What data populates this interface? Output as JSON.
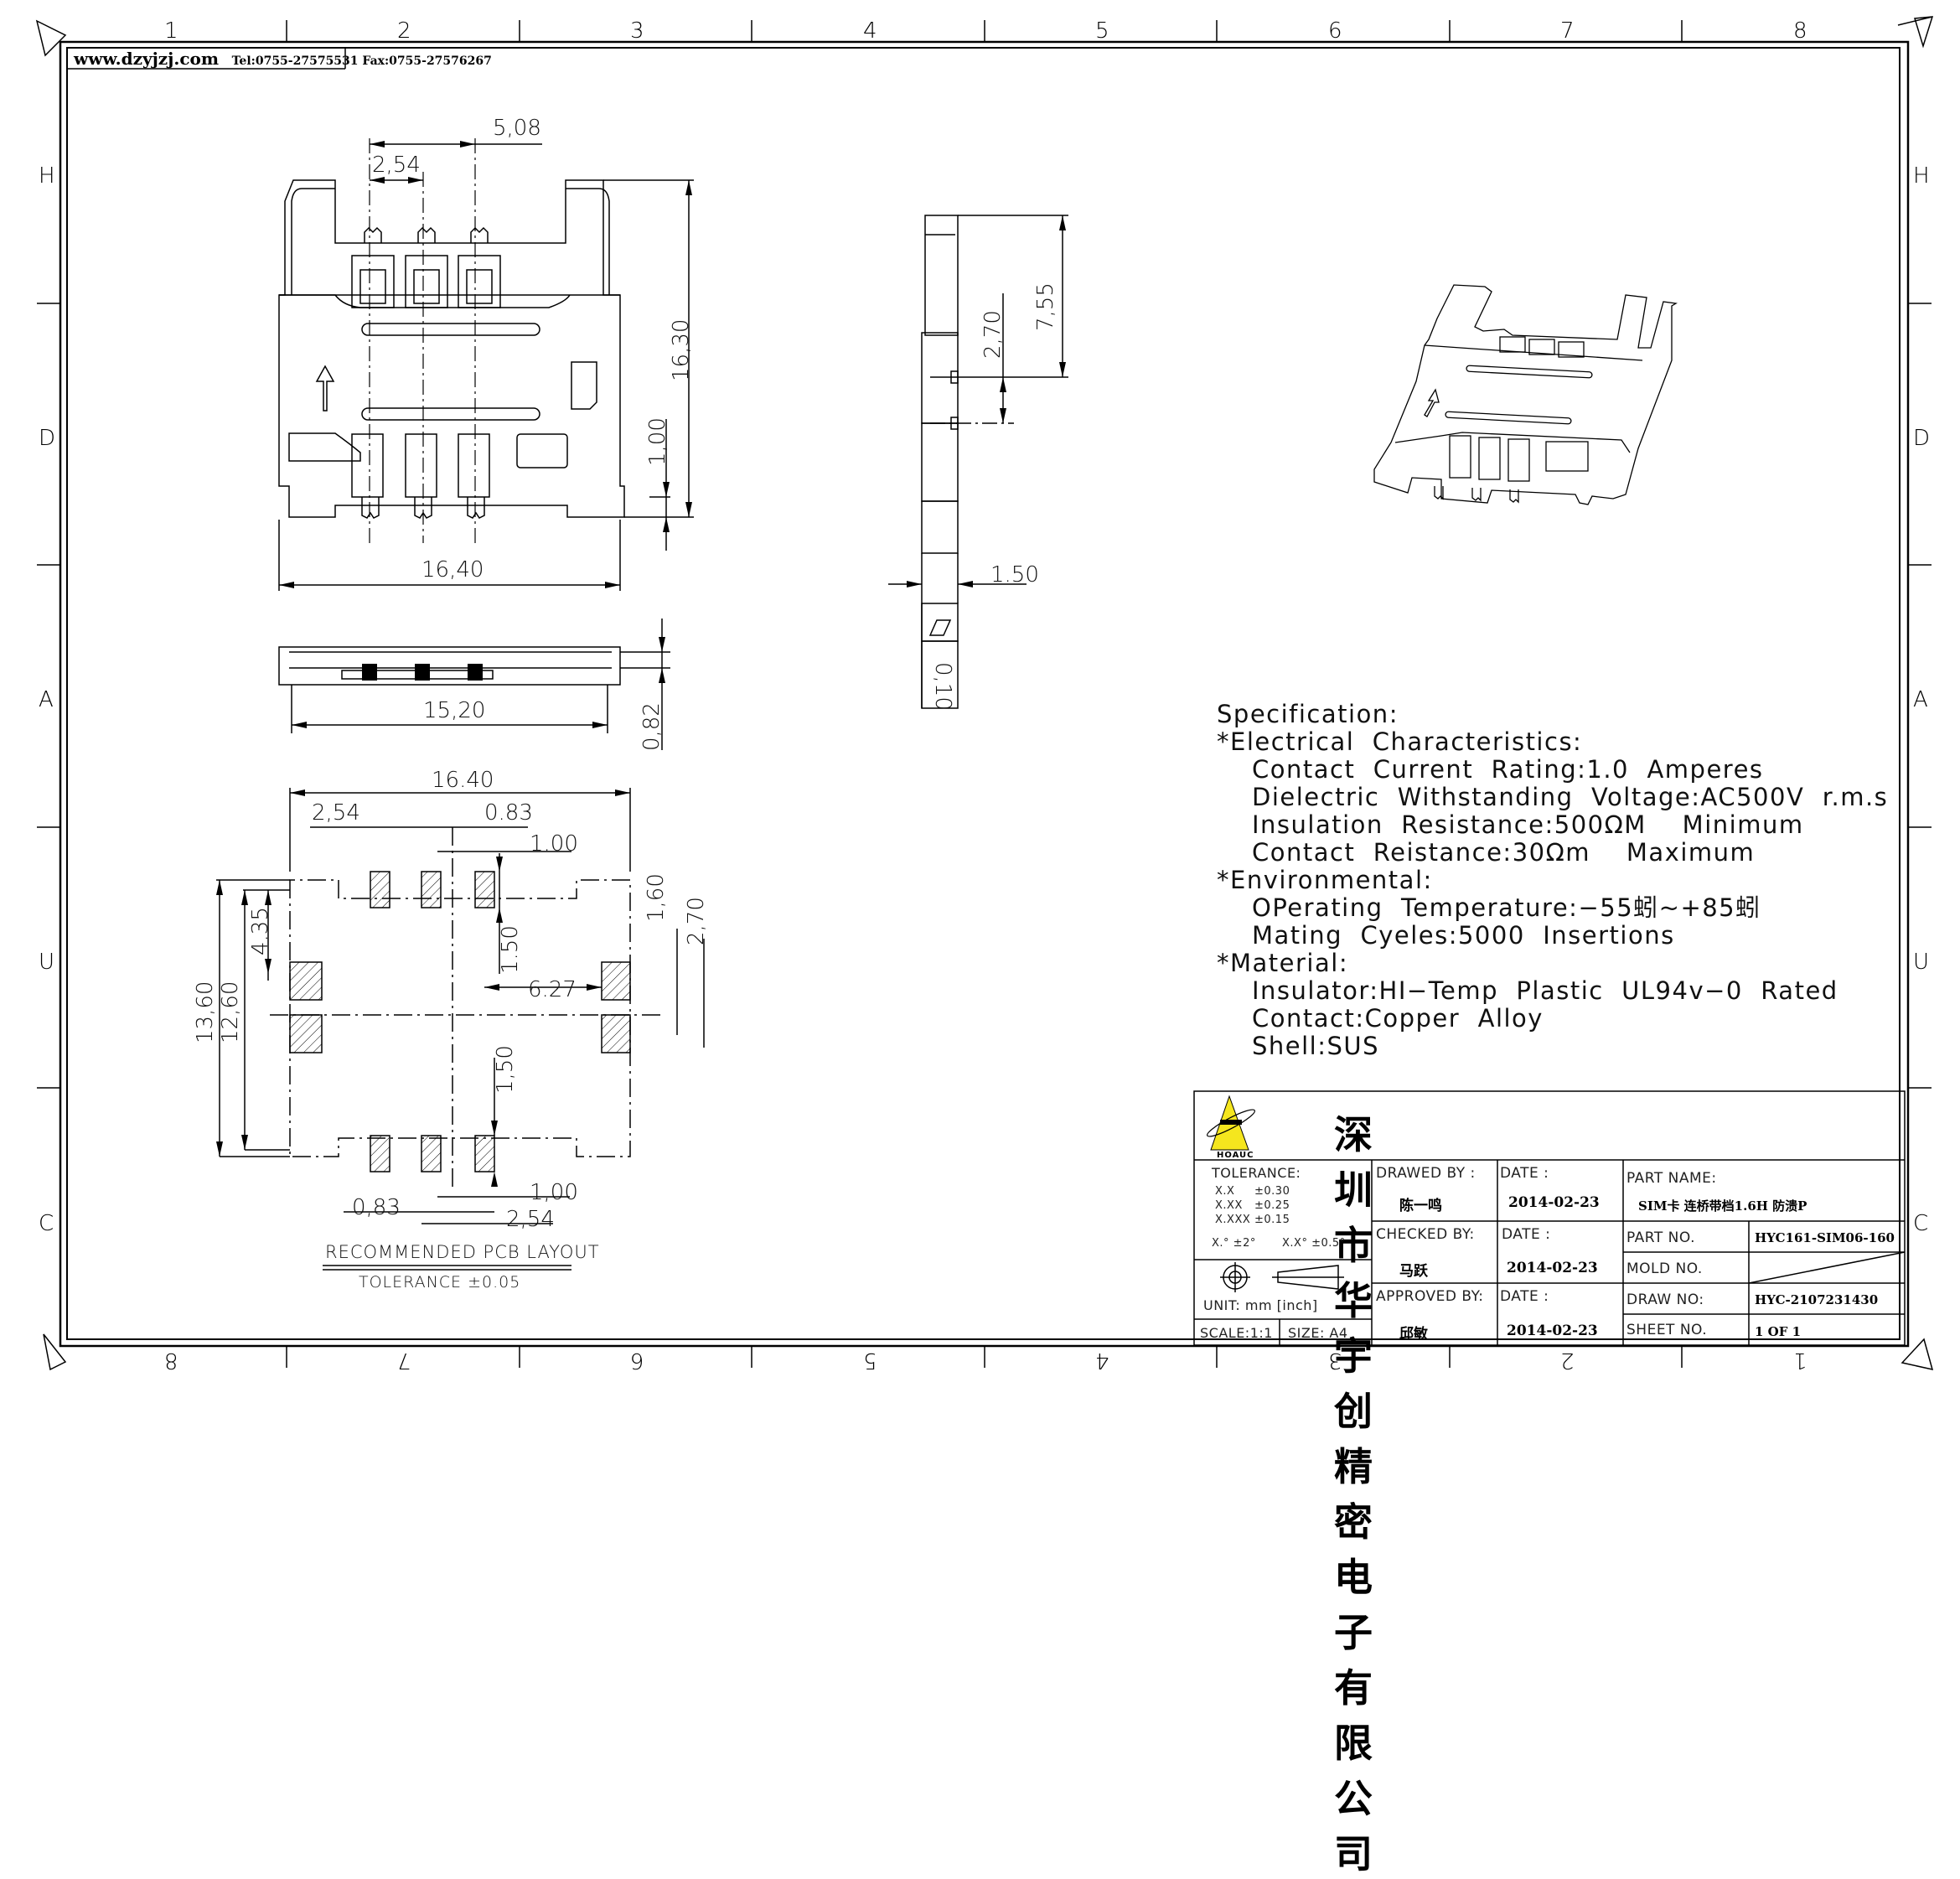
{
  "header": {
    "website": "www.dzyjzj.com",
    "contact": "Tel:0755-27575531  Fax:0755-27576267"
  },
  "border": {
    "top_columns": [
      "1",
      "2",
      "3",
      "4",
      "5",
      "6",
      "7",
      "8"
    ],
    "bottom_columns": [
      "8",
      "7",
      "6",
      "5",
      "4",
      "3",
      "2",
      "1"
    ],
    "left_rows": [
      "H",
      "D",
      "A",
      "U",
      "C"
    ],
    "right_rows": [
      "H",
      "D",
      "A",
      "U",
      "C"
    ]
  },
  "front_view": {
    "pitch": "2,54",
    "pitch_double": "5,08",
    "height": "16,30",
    "tail_offset": "1,00",
    "width": "16,40"
  },
  "bottom_view": {
    "width": "15,20",
    "height": "0,82"
  },
  "side_view": {
    "height_upper": "7,55",
    "contact_pitch": "2,70",
    "thickness": "1.50",
    "flatness_symbol": "flatness-icon",
    "flatness_value": "0,10"
  },
  "pcb_layout": {
    "overall_width": "16.40",
    "pitch_top": "2,54",
    "offset_top": "0.83",
    "pad_width_top": "1.00",
    "pad_to_center": "4.35",
    "pad_len_top": "1.50",
    "side_pad_offset": "6.27",
    "side_pad_len": "1,60",
    "side_pad_pitch": "2,70",
    "overall_height_outer": "13,60",
    "overall_height_inner": "12,60",
    "pad_len_bottom": "1,50",
    "pad_width_bottom": "1,00",
    "offset_bottom": "0,83",
    "pitch_bottom": "2,54",
    "title": "RECOMMENDED PCB LAYOUT",
    "tolerance": "TOLERANCE ±0.05"
  },
  "specification": {
    "title": "Specification:",
    "sections": [
      {
        "heading": "*Electrical  Characteristics:",
        "items": [
          "Contact  Current  Rating:1.0  Amperes",
          "Dielectric  Withstanding  Voltage:AC500V  r.m.s",
          "Insulation  Resistance:500ΩM    Minimum",
          "Contact  Reistance:30Ωm    Maximum"
        ]
      },
      {
        "heading": "*Environmental:",
        "items": [
          "OPerating  Temperature:−55蚓~+85蚓",
          "Mating  Cyeles:5000  Insertions"
        ]
      },
      {
        "heading": "*Material:",
        "items": [
          "Insulator:HI−Temp  Plastic  UL94v−0  Rated",
          "Contact:Copper  Alloy",
          "Shell:SUS"
        ]
      }
    ]
  },
  "title_block": {
    "logo_text": "HOAUC",
    "logo_color": "#f5e61e",
    "company": "深圳市华宇创精密电子有限公司",
    "tolerance_label": "TOLERANCE:",
    "tolerances": [
      {
        "k": "X.X",
        "v": "±0.30"
      },
      {
        "k": "X.XX",
        "v": "±0.25"
      },
      {
        "k": "X.XXX",
        "v": "±0.15"
      }
    ],
    "angle_tol_1": "X.° ±2°",
    "angle_tol_2": "X.X° ±0.5°",
    "unit": "UNIT:  mm  [inch]",
    "scale": "SCALE:1:1",
    "size": "SIZE:  A4",
    "drawn_by_label": "DRAWED  BY :",
    "drawn_by": "陈一鸣",
    "checked_by_label": "CHECKED  BY:",
    "checked_by": "马跃",
    "approved_by_label": "APPROVED  BY:",
    "approved_by": "邱敏",
    "date_label": "DATE  :",
    "drawn_date": "2014-02-23",
    "checked_date": "2014-02-23",
    "approved_date": "2014-02-23",
    "part_name_label": "PART  NAME:",
    "part_name": "SIM卡 连桥带档1.6H 防溃P",
    "part_no_label": "PART  NO.",
    "part_no": "HYC161-SIM06-160",
    "mold_no_label": "MOLD  NO.",
    "draw_no_label": "DRAW  NO:",
    "draw_no": "HYC-2107231430",
    "sheet_no_label": "SHEET  NO.",
    "sheet_no": "1  OF  1"
  }
}
